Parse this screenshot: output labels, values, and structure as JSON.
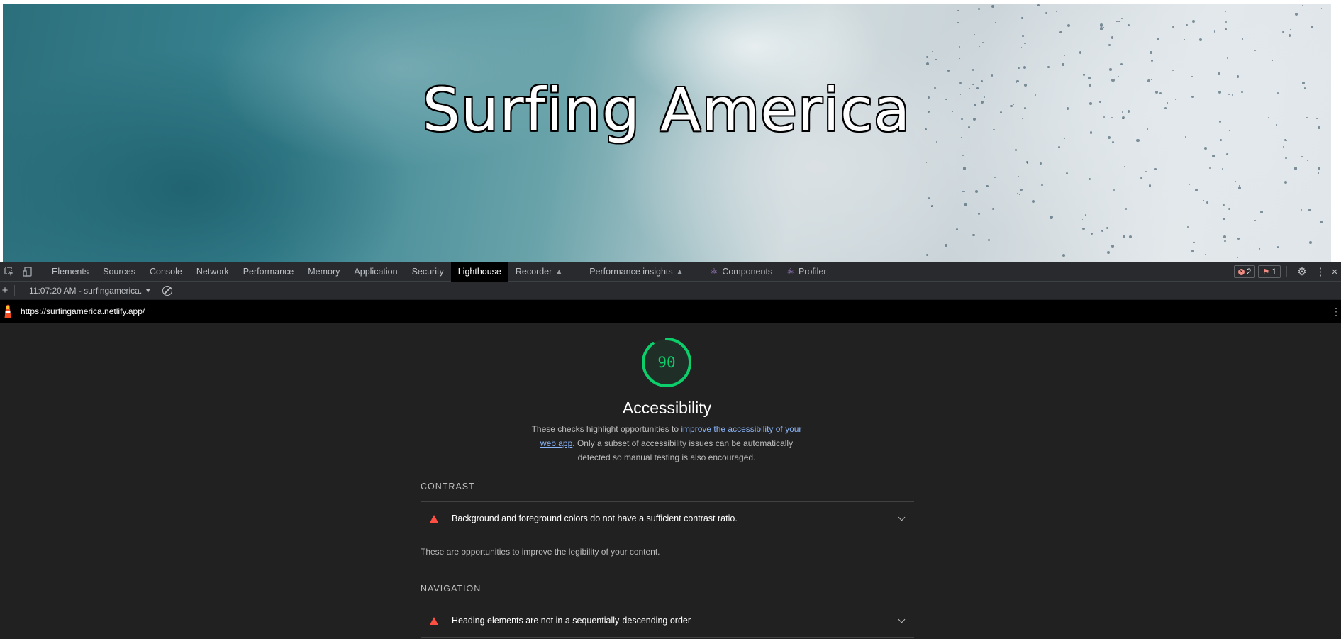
{
  "hero": {
    "title": "Surfing America"
  },
  "devtools": {
    "tabs": [
      {
        "label": "Elements"
      },
      {
        "label": "Sources"
      },
      {
        "label": "Console"
      },
      {
        "label": "Network"
      },
      {
        "label": "Performance"
      },
      {
        "label": "Memory"
      },
      {
        "label": "Application"
      },
      {
        "label": "Security"
      },
      {
        "label": "Lighthouse",
        "active": true
      },
      {
        "label": "Recorder",
        "experimental": true
      },
      {
        "label": "Performance insights",
        "experimental": true
      },
      {
        "label": "Components",
        "icon": "react-icon"
      },
      {
        "label": "Profiler",
        "icon": "react-icon"
      }
    ],
    "error_count": "2",
    "issue_count": "1"
  },
  "lighthouse_toolbar": {
    "report_label": "11:07:20 AM - surfingamerica.​"
  },
  "url_bar": {
    "url": "https://surfingamerica.netlify.app/"
  },
  "report": {
    "score": "90",
    "score_fraction": 0.9,
    "score_color": "#0cce6b",
    "category": "Accessibility",
    "description_before": "These checks highlight opportunities to ",
    "description_link": "improve the accessibility of your web app",
    "description_after": ". Only a subset of accessibility issues can be automatically detected so manual testing is also encouraged.",
    "groups": {
      "contrast": {
        "title": "CONTRAST",
        "audit": "Background and foreground colors do not have a sufficient contrast ratio.",
        "description": "These are opportunities to improve the legibility of your content."
      },
      "navigation": {
        "title": "NAVIGATION",
        "audit": "Heading elements are not in a sequentially-descending order"
      }
    }
  }
}
